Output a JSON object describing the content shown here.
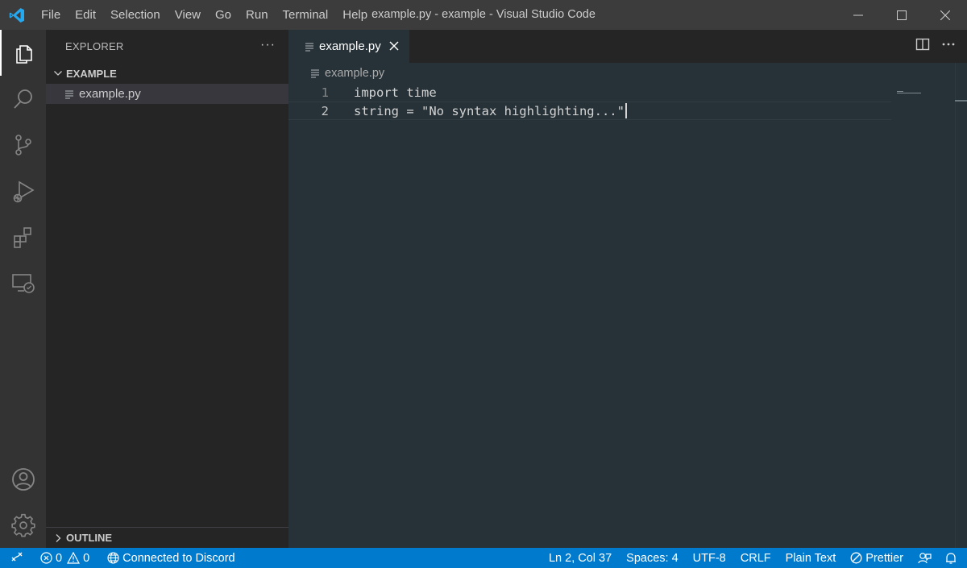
{
  "titlebar": {
    "menu": [
      "File",
      "Edit",
      "Selection",
      "View",
      "Go",
      "Run",
      "Terminal",
      "Help"
    ],
    "title": "example.py - example - Visual Studio Code"
  },
  "sidebar": {
    "title": "EXPLORER",
    "more": "···",
    "folder": "EXAMPLE",
    "files": [
      "example.py"
    ],
    "outline": "OUTLINE"
  },
  "editor": {
    "tab_label": "example.py",
    "breadcrumb": "example.py",
    "lines": [
      {
        "number": "1",
        "text": "import time"
      },
      {
        "number": "2",
        "text": "string = \"No syntax highlighting...\""
      }
    ]
  },
  "statusbar": {
    "errors": "0",
    "warnings": "0",
    "discord": "Connected to Discord",
    "position": "Ln 2, Col 37",
    "spaces": "Spaces: 4",
    "encoding": "UTF-8",
    "eol": "CRLF",
    "language": "Plain Text",
    "prettier": "Prettier"
  },
  "colors": {
    "titlebar": "#3c3c3c",
    "activitybar": "#333333",
    "sidebar": "#252526",
    "editor": "#263238",
    "statusbar": "#007acc",
    "logo": "#23a9f2"
  },
  "icons": {
    "activity": [
      "files-icon",
      "search-icon",
      "source-control-icon",
      "run-debug-icon",
      "extensions-icon",
      "remote-explorer-icon",
      "account-icon",
      "settings-gear-icon"
    ]
  }
}
